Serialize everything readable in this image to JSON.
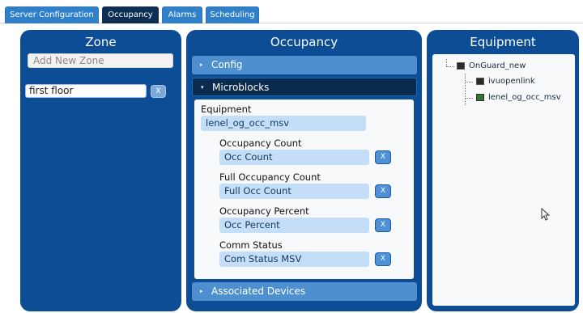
{
  "tabs": [
    {
      "label": "Server Configuration"
    },
    {
      "label": "Occupancy"
    },
    {
      "label": "Alarms"
    },
    {
      "label": "Scheduling"
    }
  ],
  "zone": {
    "title": "Zone",
    "add_placeholder": "Add New Zone",
    "items": [
      {
        "label": "first floor",
        "remove": "X"
      }
    ]
  },
  "occupancy": {
    "title": "Occupancy",
    "sections": {
      "config": "Config",
      "microblocks": "Microblocks",
      "associated": "Associated Devices"
    },
    "equipment_label": "Equipment",
    "equipment_value": "lenel_og_occ_msv",
    "fields": [
      {
        "label": "Occupancy Count",
        "value": "Occ Count",
        "remove": "X"
      },
      {
        "label": "Full Occupancy Count",
        "value": "Full Occ Count",
        "remove": "X"
      },
      {
        "label": "Occupancy Percent",
        "value": "Occ Percent",
        "remove": "X"
      },
      {
        "label": "Comm Status",
        "value": "Com Status MSV",
        "remove": "X"
      }
    ]
  },
  "equipment": {
    "title": "Equipment",
    "tree": {
      "root": "OnGuard_new",
      "children": [
        "ivuopenlink",
        "lenel_og_occ_msv"
      ]
    }
  },
  "colors": {
    "panel": "#0c4d96",
    "tab": "#2f80c8",
    "tab_active": "#0e2f54",
    "field_bg": "#c5def8"
  },
  "icons": [
    "caret-right-icon",
    "caret-down-icon",
    "server-icon",
    "device-icon",
    "mouse-cursor-icon"
  ]
}
